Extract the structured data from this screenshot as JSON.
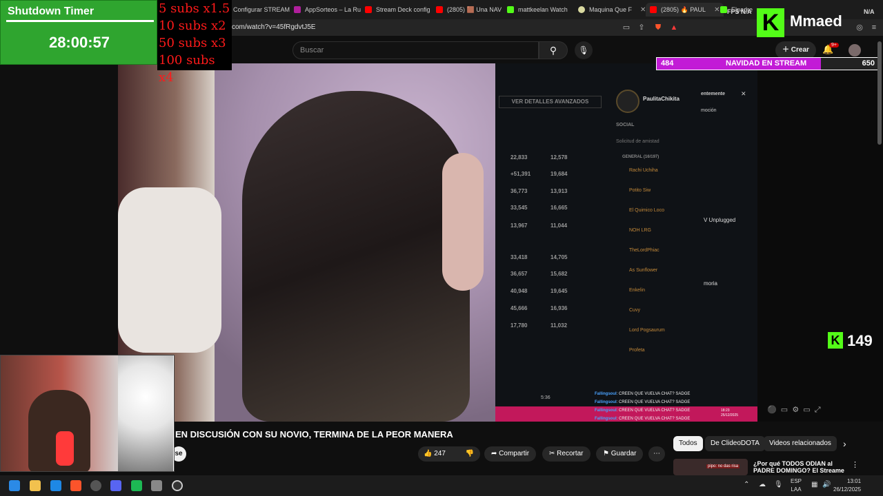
{
  "browser": {
    "tabs": [
      {
        "label": "Configurar STREAM",
        "color": "#9c27b0"
      },
      {
        "label": "AppSorteos – La Ru",
        "color": "#b01f9c"
      },
      {
        "label": "Stream Deck config",
        "color": "#ff0000"
      },
      {
        "label": "(2805) 🟫 Una NAV",
        "color": "#ff0000"
      },
      {
        "label": "mattkeelan  Watch",
        "color": "#53fc18"
      },
      {
        "label": "Maquina Que F",
        "color": "#d9d9a0"
      },
      {
        "label": "(2805) 🔥 PAUL",
        "color": "#ff0000"
      },
      {
        "label": "Elpadre",
        "color": "#53fc18"
      }
    ],
    "url": "com/watch?v=45fRgdvtJ5E",
    "fps_label": "FPS",
    "fps_value": "N/A",
    "fps_value2": "N/A"
  },
  "youtube": {
    "search_placeholder": "Buscar",
    "create_label": "Crear",
    "notif_badge": "9+",
    "title": "EN DISCUSIÓN CON SU NOVIO, TERMINA DE LA PEOR MANERA",
    "likes": "247",
    "share": "Compartir",
    "clip": "Recortar",
    "save": "Guardar",
    "subscribe_fragment": "se",
    "chips": [
      "Todos",
      "De ClideoDOTA",
      "Videos relacionados"
    ],
    "rec_title": "¿Por qué TODOS ODIAN al PADRE DOMINGO? El Streame",
    "rec_chat": "pipo: no das risa"
  },
  "overlay": {
    "timer_title": "Shutdown Timer",
    "timer_value": "28:00:57",
    "subs_rules": [
      "5 subs x1.5",
      "10 subs x2",
      "50 subs x3",
      "100 subs x4"
    ],
    "brand": "Mmaed",
    "goal_left": "484",
    "goal_label": "NAVIDAD EN STREAM",
    "goal_right": "650",
    "goal_progress": 0.745,
    "viewers": "149"
  },
  "video": {
    "detail_button": "VER DETALLES AVANZADOS",
    "profile_name": "PaulitaChikita",
    "social_label": "SOCIAL",
    "friend_request": "Solicitud de amistad",
    "general_label": "GENERAL (16/197)",
    "friends": [
      "Rachi Uchiha",
      "Potito Siw",
      "El Quimico Loco",
      "NOH LRG",
      "TheLordPhiac",
      "As Sunflower",
      "Enkelin",
      "Cuvy",
      "Lord Pogsaurum",
      "Profeta"
    ],
    "stats_left": [
      "22,833",
      "+51,391",
      "36,773",
      "33,545",
      "13,967",
      "33,418",
      "36,657",
      "40,948",
      "45,666",
      "17,780"
    ],
    "stats_right": [
      "12,578",
      "19,684",
      "13,913",
      "16,665",
      "11,044",
      "14,705",
      "15,682",
      "19,645",
      "16,936",
      "11,032"
    ],
    "side_labels": {
      "unplugged": "V Unplugged",
      "memoria": "moria",
      "mente": "entemente",
      "mocion": "moción"
    },
    "time": "5:36",
    "chat_user": "Fallingsoul",
    "chat_msg": ": CREEN QUE VUELVA CHAT? SADGE",
    "clock_small_time": "18:23",
    "clock_small_date": "25/12/2025"
  },
  "taskbar": {
    "lang1": "ESP",
    "lang2": "LAA",
    "time": "13:01",
    "date": "26/12/2025"
  }
}
